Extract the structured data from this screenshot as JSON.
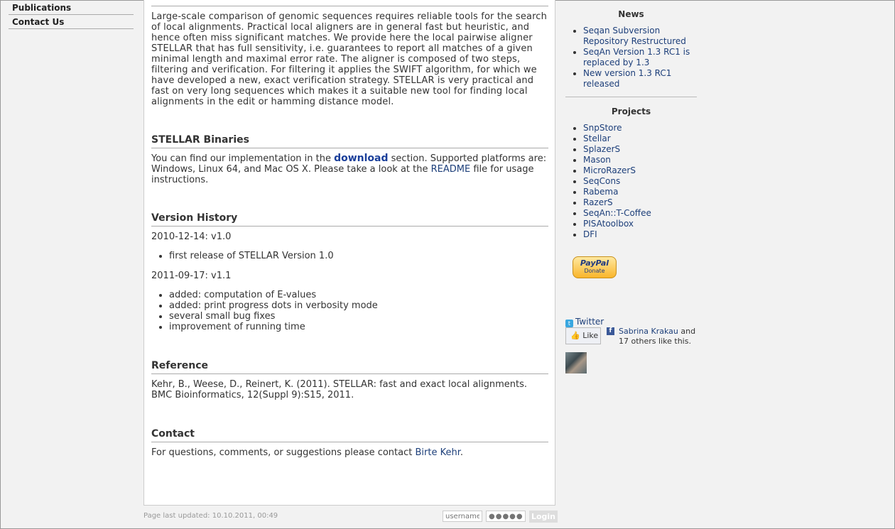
{
  "nav": {
    "items": [
      "Publications",
      "Contact Us"
    ]
  },
  "main": {
    "intro": "Large-scale comparison of genomic sequences requires reliable tools for the search of local alignments. Practical local aligners are in general fast but heuristic, and hence often miss significant matches. We provide here the local pairwise aligner STELLAR that has full sensitivity, i.e. guarantees to report all matches of a given minimal length and maximal error rate. The aligner is composed of two steps, filtering and verification. For filtering it applies the SWIFT algorithm, for which we have developed a new, exact verification strategy. STELLAR is very practical and fast on very long sequences which makes it a suitable new tool for finding local alignments in the edit or hamming distance model.",
    "binaries": {
      "heading": "STELLAR Binaries",
      "text_before": "You can find our implementation in the ",
      "download_link": "download",
      "text_middle": " section. Supported platforms are: Windows, Linux 64, and Mac OS X. Please take a look at the ",
      "readme_link": "README",
      "text_after": " file for usage instructions."
    },
    "history": {
      "heading": "Version History",
      "v1_date": "2010-12-14: v1.0",
      "v1_items": [
        "first release of STELLAR Version 1.0"
      ],
      "v2_date": "2011-09-17: v1.1",
      "v2_items": [
        "added: computation of E-values",
        "added: print progress dots in verbosity mode",
        "several small bug fixes",
        "improvement of running time"
      ]
    },
    "reference": {
      "heading": "Reference",
      "text": "Kehr, B., Weese, D., Reinert, K. (2011). STELLAR: fast and exact local alignments. BMC Bioinformatics, 12(Suppl 9):S15, 2011."
    },
    "contact": {
      "heading": "Contact",
      "text_before": "For questions, comments, or suggestions please contact ",
      "link": "Birte Kehr",
      "text_after": "."
    }
  },
  "footer": {
    "updated": "Page last updated: 10.10.2011, 00:49",
    "username_placeholder": "username",
    "password_placeholder": "●●●●●●●●",
    "login_label": "Login"
  },
  "sidebar": {
    "news_title": "News",
    "news": [
      "Seqan Subversion Repository Restructured",
      "SeqAn Version 1.3 RC1 is replaced by 1.3",
      "New version 1.3 RC1 released"
    ],
    "projects_title": "Projects",
    "projects": [
      "SnpStore",
      "Stellar",
      "SplazerS",
      "Mason",
      "MicroRazerS",
      "SeqCons",
      "Rabema",
      "RazerS",
      "SeqAn::T-Coffee",
      "PISAtoolbox",
      "DFI"
    ],
    "paypal": {
      "brand": "PayPal",
      "label": "Donate"
    },
    "twitter_label": "Twitter",
    "like_label": "Like",
    "fb_name": "Sabrina Krakau",
    "fb_rest": " and 17 others like this."
  },
  "icons": {
    "twitter": "twitter-icon",
    "facebook": "facebook-icon",
    "like": "thumbs-up-icon"
  }
}
